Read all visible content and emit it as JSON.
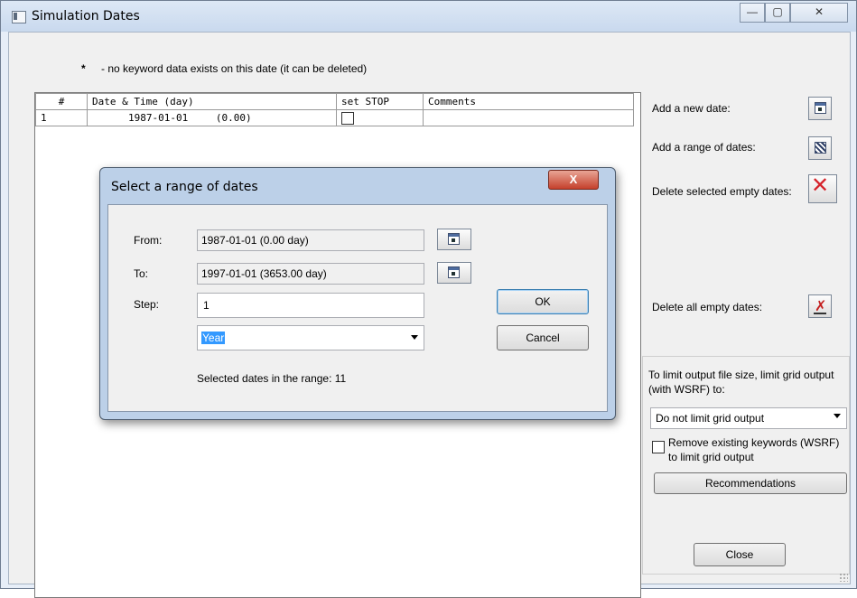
{
  "window": {
    "title": "Simulation Dates",
    "minimize": "—",
    "maximize": "▢",
    "close": "✕"
  },
  "legend": {
    "symbol": "*",
    "text": "- no keyword data exists on this date (it can be deleted)"
  },
  "table": {
    "headers": [
      "#",
      "Date & Time (day)",
      "set STOP",
      "Comments"
    ],
    "rows": [
      {
        "num": "1",
        "date": "1987-01-01",
        "day": "(0.00)",
        "stop": false,
        "comments": ""
      }
    ]
  },
  "side": {
    "add_date_label": "Add a new date:",
    "add_range_label": "Add a range of dates:",
    "delete_selected_label": "Delete selected empty dates:",
    "delete_all_label": "Delete all empty dates:",
    "limit_text": "To limit output file size, limit grid output (with WSRF) to:",
    "limit_select": "Do not limit grid output",
    "remove_keywords_label": "Remove existing keywords (WSRF) to limit grid output",
    "recommendations": "Recommendations",
    "close_button": "Close"
  },
  "dialog": {
    "title": "Select a range of dates",
    "close": "X",
    "from_label": "From:",
    "from_value": "1987-01-01 (0.00 day)",
    "to_label": "To:",
    "to_value": "1997-01-01 (3653.00 day)",
    "step_label": "Step:",
    "step_value": "1",
    "unit_value": "Year",
    "ok": "OK",
    "cancel": "Cancel",
    "summary": "Selected dates in the range: 11"
  }
}
